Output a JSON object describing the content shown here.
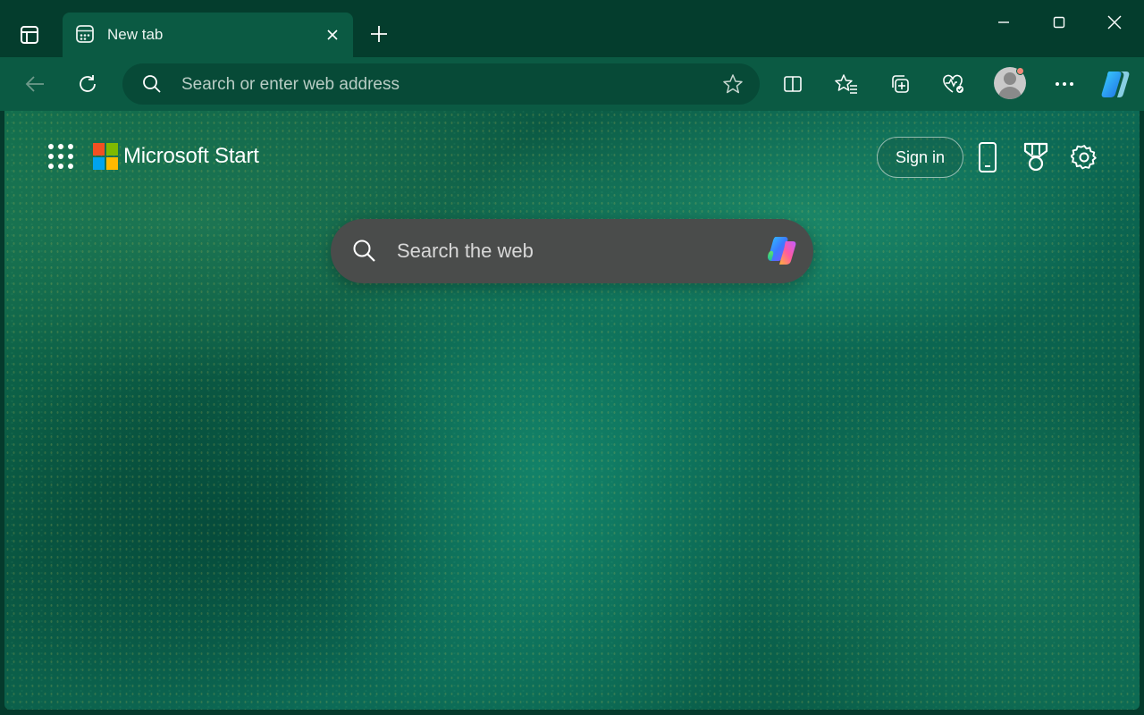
{
  "tab": {
    "title": "New tab"
  },
  "addressbar": {
    "placeholder": "Search or enter web address"
  },
  "page": {
    "brand": "Microsoft Start",
    "sign_in_label": "Sign in",
    "search_placeholder": "Search the web"
  },
  "icons": {
    "tab_actions": "tab-actions-icon",
    "favicon": "new-tab-page-icon",
    "close": "close-icon",
    "new_tab": "plus-icon",
    "back": "back-arrow-icon",
    "refresh": "refresh-icon",
    "search": "search-icon",
    "favorite": "star-icon",
    "split_screen": "split-screen-icon",
    "favorites": "favorites-icon",
    "collections": "collections-icon",
    "browser_essentials": "heart-pulse-icon",
    "profile": "profile-avatar-icon",
    "more": "ellipsis-icon",
    "copilot": "copilot-icon",
    "apps": "app-launcher-icon",
    "mobile": "phone-icon",
    "rewards": "rewards-medal-icon",
    "settings": "gear-icon"
  },
  "colors": {
    "titlebar": "#043d2d",
    "toolbar": "#0b5a43",
    "addressbar": "#074a37",
    "search_box": "#4a4c4b",
    "ms_red": "#f25022",
    "ms_green": "#7fba00",
    "ms_blue": "#00a4ef",
    "ms_yellow": "#ffb900"
  }
}
